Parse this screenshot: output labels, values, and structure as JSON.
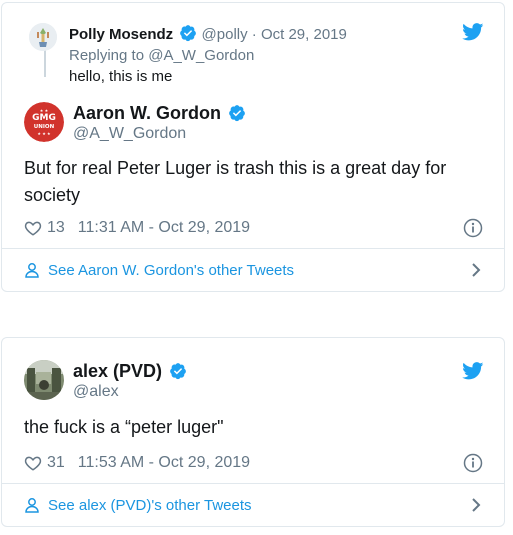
{
  "colors": {
    "link": "#1b95e0",
    "muted": "#657786",
    "text": "#14171a",
    "border": "#e1e8ed",
    "verified": "#1da1f2"
  },
  "tweet1": {
    "parent": {
      "name": "Polly Mosendz",
      "handle": "@polly",
      "separator": "·",
      "date": "Oct 29, 2019",
      "replying_to": "Replying to @A_W_Gordon",
      "text": "hello, this is me"
    },
    "author": {
      "name": "Aaron W. Gordon",
      "handle": "@A_W_Gordon",
      "avatar_text_top": "GMG",
      "avatar_text_bottom": "UNION"
    },
    "text": "But for real Peter Luger is trash this is a great day for society",
    "likes": "13",
    "timestamp": "11:31 AM - Oct 29, 2019",
    "footer_link": "See Aaron W. Gordon's other Tweets"
  },
  "tweet2": {
    "author": {
      "name": "alex (PVD)",
      "handle": "@alex"
    },
    "text": "the fuck is a “peter luger\"",
    "likes": "31",
    "timestamp": "11:53 AM - Oct 29, 2019",
    "footer_link": "See alex (PVD)'s other Tweets"
  },
  "icons": [
    "twitter-bird-icon",
    "verified-badge-icon",
    "heart-icon",
    "info-icon",
    "person-icon",
    "chevron-right-icon"
  ]
}
